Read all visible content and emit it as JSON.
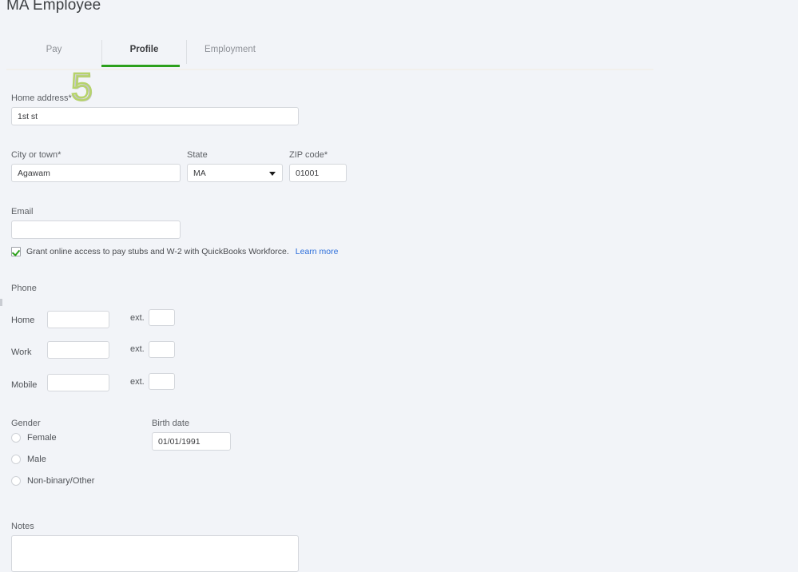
{
  "page": {
    "title": "MA Employee",
    "background_color": "#f2f4f8",
    "accent_color": "#2ca01c",
    "link_color": "#2e6fdb"
  },
  "tabs": [
    {
      "label": "Pay",
      "active": false
    },
    {
      "label": "Profile",
      "active": true
    },
    {
      "label": "Employment",
      "active": false
    }
  ],
  "watermark": {
    "text": "5",
    "outline_color": "#b6d36b"
  },
  "form": {
    "home_address": {
      "label": "Home address*",
      "value": "1st st",
      "placeholder": ""
    },
    "city": {
      "label": "City or town*",
      "value": "Agawam",
      "placeholder": ""
    },
    "state": {
      "label": "State",
      "value": "MA",
      "icon": "chevron-down-icon"
    },
    "zip": {
      "label": "ZIP code*",
      "value": "01001",
      "placeholder": ""
    },
    "email": {
      "label": "Email",
      "value": "",
      "placeholder": ""
    },
    "workforce_access": {
      "label": "Grant online access to pay stubs and W-2 with QuickBooks Workforce.",
      "checked": true,
      "link_label": "Learn more"
    },
    "phone": {
      "section_label": "Phone",
      "ext_label": "ext.",
      "rows": [
        {
          "label": "Home",
          "number": "",
          "ext": ""
        },
        {
          "label": "Work",
          "number": "",
          "ext": ""
        },
        {
          "label": "Mobile",
          "number": "",
          "ext": ""
        }
      ]
    },
    "gender": {
      "label": "Gender",
      "options": [
        {
          "label": "Female",
          "selected": false
        },
        {
          "label": "Male",
          "selected": false
        },
        {
          "label": "Non-binary/Other",
          "selected": false
        }
      ]
    },
    "birth_date": {
      "label": "Birth date",
      "value": "01/01/1991",
      "placeholder": ""
    },
    "notes": {
      "label": "Notes",
      "value": "",
      "placeholder": ""
    }
  }
}
